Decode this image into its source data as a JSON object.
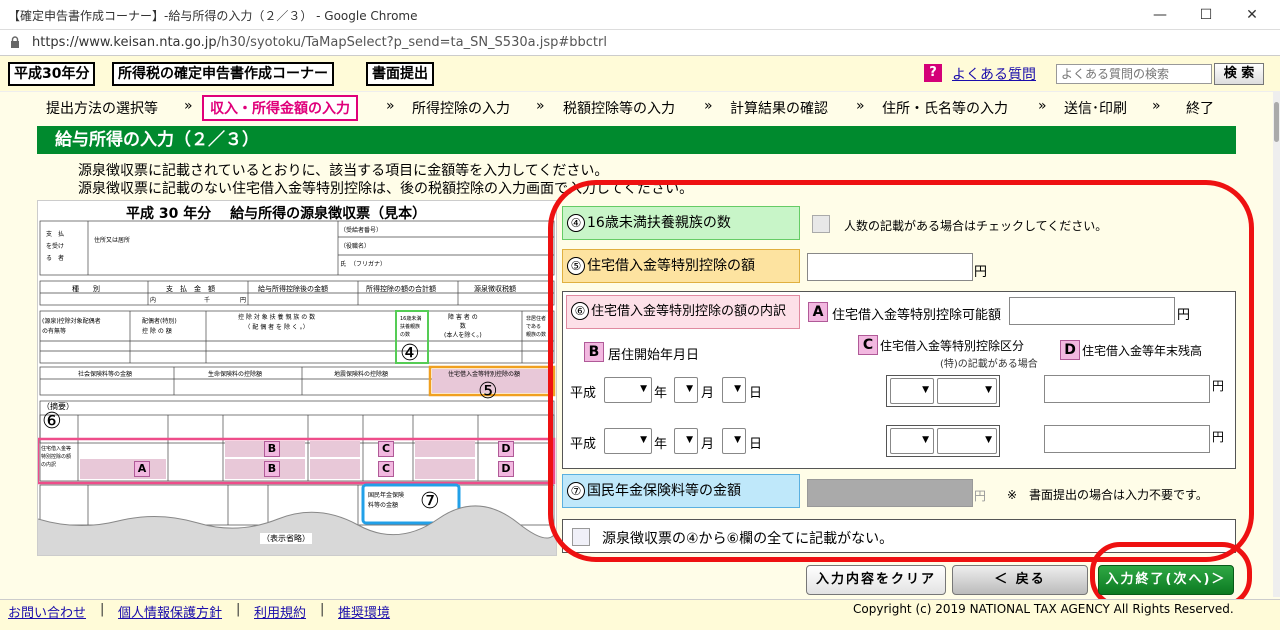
{
  "window": {
    "title": "【確定申告書作成コーナー】-給与所得の入力（２／３） - Google Chrome",
    "minimize": "—",
    "maximize": "☐",
    "close": "✕"
  },
  "address": {
    "url_host": "https://www.keisan.nta.go.jp",
    "url_path": "/h30/syotoku/TaMapSelect?p_send=ta_SN_S530a.jsp#bbctrl"
  },
  "header": {
    "year": "平成30年分",
    "corner": "所得税の確定申告書作成コーナー",
    "mode": "書面提出",
    "faq_link": "よくある質問",
    "faq_placeholder": "よくある質問の検索",
    "search_button": "検 索"
  },
  "steps": {
    "items": [
      "提出方法の選択等",
      "収入・所得金額の入力",
      "所得控除の入力",
      "税額控除等の入力",
      "計算結果の確認",
      "住所・氏名等の入力",
      "送信･印刷",
      "終了"
    ],
    "sep": "»"
  },
  "page": {
    "title": "給与所得の入力（２／３）",
    "instruction1": "源泉徴収票に記載されているとおりに、該当する項目に金額等を入力してください。",
    "instruction2": "源泉徴収票に記載のない住宅借入金等特別控除は、後の税額控除の入力画面で入力してください。"
  },
  "sheet": {
    "heading": "平成 30 年分　 給与所得の源泉徴収票（見本）",
    "label_payee": "支　払\nを受け\nる　者",
    "label_addr": "住所又は居所",
    "label_id": "（受給者番号）",
    "label_post": "（役職名）",
    "label_kana": "（フリガナ）",
    "label_name": "氏",
    "col_type": "種　　別",
    "col_pay": "支　払　金　額",
    "col_after": "給与所得控除後の金額",
    "col_deduct": "所得控除の額の合計額",
    "col_tax": "源泉徴収税額",
    "unit_uchi": "内",
    "unit_sen": "千",
    "unit_en": "円",
    "spouse": "(源泉)控除対象配偶者\nの有無等",
    "spouse_special": "配偶者(特別)\n控 除 の 額",
    "dependents": "控 除 対 象 扶 養 親 族 の 数\n（ 配 偶 者 を 除 く 。）",
    "under16": "16歳未満\n扶養親族\nの数",
    "disabled": "障 害 者 の\n数\n(本人を除く。)",
    "nonresident": "非居住者\nである\n親族の数",
    "social": "社会保険料等の金額",
    "life": "生命保険料の控除額",
    "quake": "地震保険料の控除額",
    "housing_amt": "住宅借入金等特別控除の額",
    "tekiyou": "（摘要）",
    "housing_detail": "住宅借入金等\n特別控除の額\nの内訳",
    "pension": "国民年金保険\n料等の金額",
    "omit": "（表示省略）",
    "marker4": "④",
    "marker5": "⑤",
    "marker6": "⑥",
    "marker7": "⑦",
    "boxA": "A",
    "boxB": "B",
    "boxC": "C",
    "boxD": "D"
  },
  "form": {
    "under16_label": "16歳未満扶養親族の数",
    "under16_num": "④",
    "under16_check": "人数の記載がある場合はチェックしてください。",
    "housing_label": "住宅借入金等特別控除の額",
    "housing_num": "⑤",
    "yen": "円",
    "detail_label": "住宅借入金等特別控除の額の内訳",
    "detail_num": "⑥",
    "a_letter": "A",
    "a_label": "住宅借入金等特別控除可能額",
    "b_letter": "B",
    "b_label": "居住開始年月日",
    "c_letter": "C",
    "c_label": "住宅借入金等特別控除区分",
    "c_sub": "(特)の記載がある場合",
    "d_letter": "D",
    "d_label": "住宅借入金等年末残高",
    "era": "平成",
    "nen": "年",
    "tsuki": "月",
    "hi": "日",
    "pension_label": "国民年金保険料等の金額",
    "pension_num": "⑦",
    "pension_note": "※　書面提出の場合は入力不要です。",
    "none_label": "源泉徴収票の④から⑥欄の全てに記載がない。"
  },
  "buttons": {
    "clear": "入力内容をクリア",
    "back": "＜ 戻る",
    "next": "入力終了(次へ)＞"
  },
  "footer": {
    "contact": "お問い合わせ",
    "privacy": "個人情報保護方針",
    "terms": "利用規約",
    "env": "推奨環境",
    "sep": "|",
    "copyright": "Copyright (c) 2019 NATIONAL TAX AGENCY All Rights Reserved."
  },
  "colors": {
    "green": "#008a2e",
    "pink": "#e0007b",
    "red_annotation": "#ee1111"
  }
}
